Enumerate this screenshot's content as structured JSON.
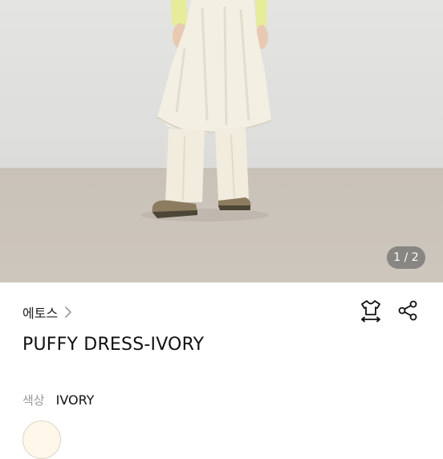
{
  "gallery": {
    "page_indicator": "1 / 2"
  },
  "product": {
    "brand": "에토스",
    "title": "PUFFY DRESS-IVORY",
    "color_label": "색상",
    "color_value": "IVORY"
  },
  "icons": {
    "brand_chevron": "chevron-right-icon",
    "size_guide": "shirt-size-icon",
    "share": "share-icon"
  },
  "colors": {
    "swatch": "#fff7e9",
    "indicator_bg": "#6e6e6e"
  }
}
